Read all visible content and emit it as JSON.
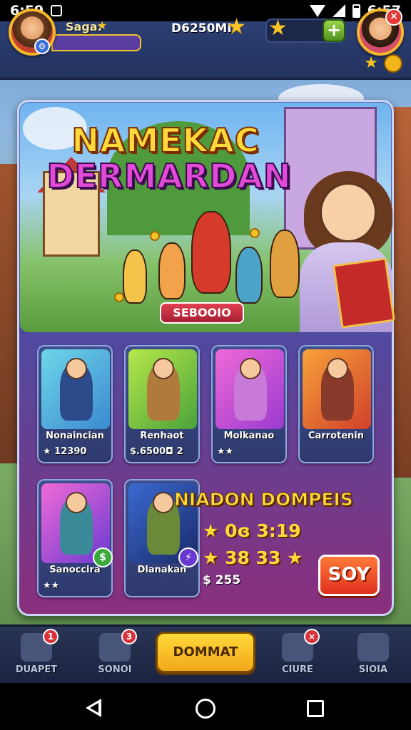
{
  "status_bar": {
    "time_left": "6:59",
    "time_right": "6:57"
  },
  "header": {
    "player_name": "Saga:",
    "coins": "D6250MI",
    "plus_label": "+",
    "close_label": "×"
  },
  "banner": {
    "title_line1": "NAMEKAC",
    "title_line2": "DERMARDAN",
    "badge": "SEBOOIO"
  },
  "cards": [
    {
      "title": "Nonaincian",
      "sub": "★ 12390"
    },
    {
      "title": "Renhaot",
      "sub": "$.6500◘ 2"
    },
    {
      "title": "Molkanao",
      "sub": "★★"
    },
    {
      "title": "Carrotenin",
      "sub": ""
    },
    {
      "title": "Sanoccira",
      "sub": "★★"
    },
    {
      "title": "Dlanakan",
      "sub": ""
    }
  ],
  "promo": {
    "title": "NIADON DOMPEIS",
    "line1": "★ 0ɞ 3:19",
    "line2": "★ 38 33 ★",
    "small": "$ 255",
    "play_label": "SOY"
  },
  "bottom_nav": {
    "items": [
      {
        "label": "DUAPET",
        "badge": "1"
      },
      {
        "label": "SONOI",
        "badge": "3"
      },
      {
        "label": "CIURE",
        "badge": "×"
      },
      {
        "label": "SIOIA",
        "badge": ""
      }
    ],
    "main_label": "DOMMAT"
  },
  "colors": {
    "accent_gold": "#ffd93a",
    "accent_magenta": "#e24bd7",
    "play_red": "#e0301e",
    "panel_blue": "#4f4aa0"
  },
  "icons": [
    "notification-icon",
    "wifi-icon",
    "signal-icon",
    "battery-icon",
    "star-icon",
    "plus-icon",
    "close-icon",
    "back-icon",
    "home-icon",
    "recents-icon"
  ]
}
